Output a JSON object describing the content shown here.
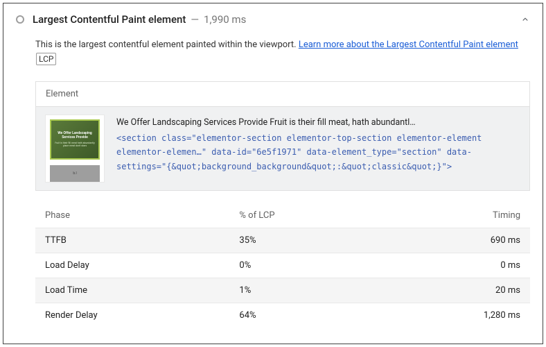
{
  "header": {
    "title": "Largest Contentful Paint element",
    "separator": "—",
    "timing": "1,990 ms"
  },
  "description": {
    "text": "This is the largest contentful element painted within the viewport. ",
    "link_text": "Learn more about the Largest Contentful Paint element",
    "chip": "LCP"
  },
  "element": {
    "header": "Element",
    "visible_text": "We Offer Landscaping Services Provide Fruit is their fill meat, hath abundantl…",
    "code": "<section class=\"elementor-section elementor-top-section elementor-element elementor-elemen…\" data-id=\"6e5f1971\" data-element_type=\"section\" data-settings=\"{&quot;background_background&quot;:&quot;classic&quot;}\">",
    "thumb_title": "We Offer Landscaping Services Provide",
    "thumb_sub": "Fruit is their fill meat hath abundantly place meat don't stars"
  },
  "phase_table": {
    "headers": [
      "Phase",
      "% of LCP",
      "Timing"
    ],
    "rows": [
      {
        "phase": "TTFB",
        "pct": "35%",
        "timing": "690 ms"
      },
      {
        "phase": "Load Delay",
        "pct": "0%",
        "timing": "0 ms"
      },
      {
        "phase": "Load Time",
        "pct": "1%",
        "timing": "20 ms"
      },
      {
        "phase": "Render Delay",
        "pct": "64%",
        "timing": "1,280 ms"
      }
    ]
  }
}
